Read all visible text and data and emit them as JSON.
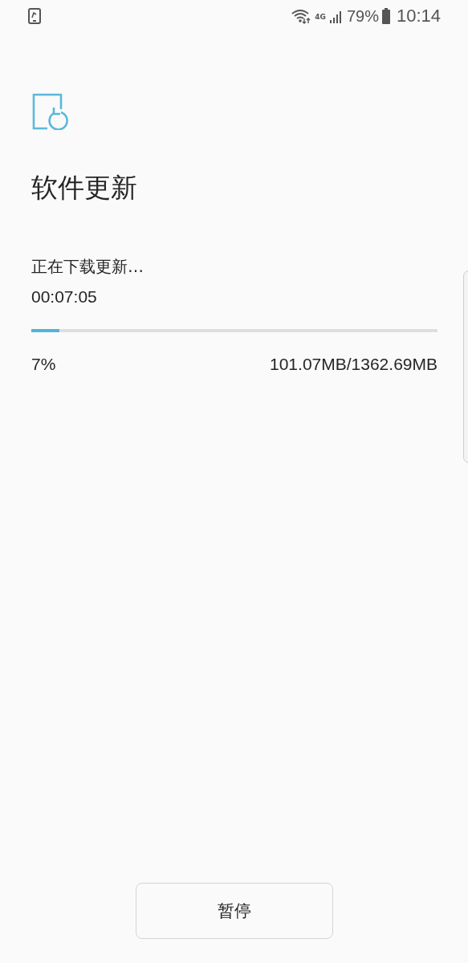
{
  "status_bar": {
    "signal_label": "4G",
    "battery": "79%",
    "time": "10:14"
  },
  "title": "软件更新",
  "status_text": "正在下载更新…",
  "elapsed": "00:07:05",
  "progress": {
    "level": 0.07,
    "percent": "7%",
    "size": "101.07MB/1362.69MB"
  },
  "buttons": [
    "暂停"
  ]
}
